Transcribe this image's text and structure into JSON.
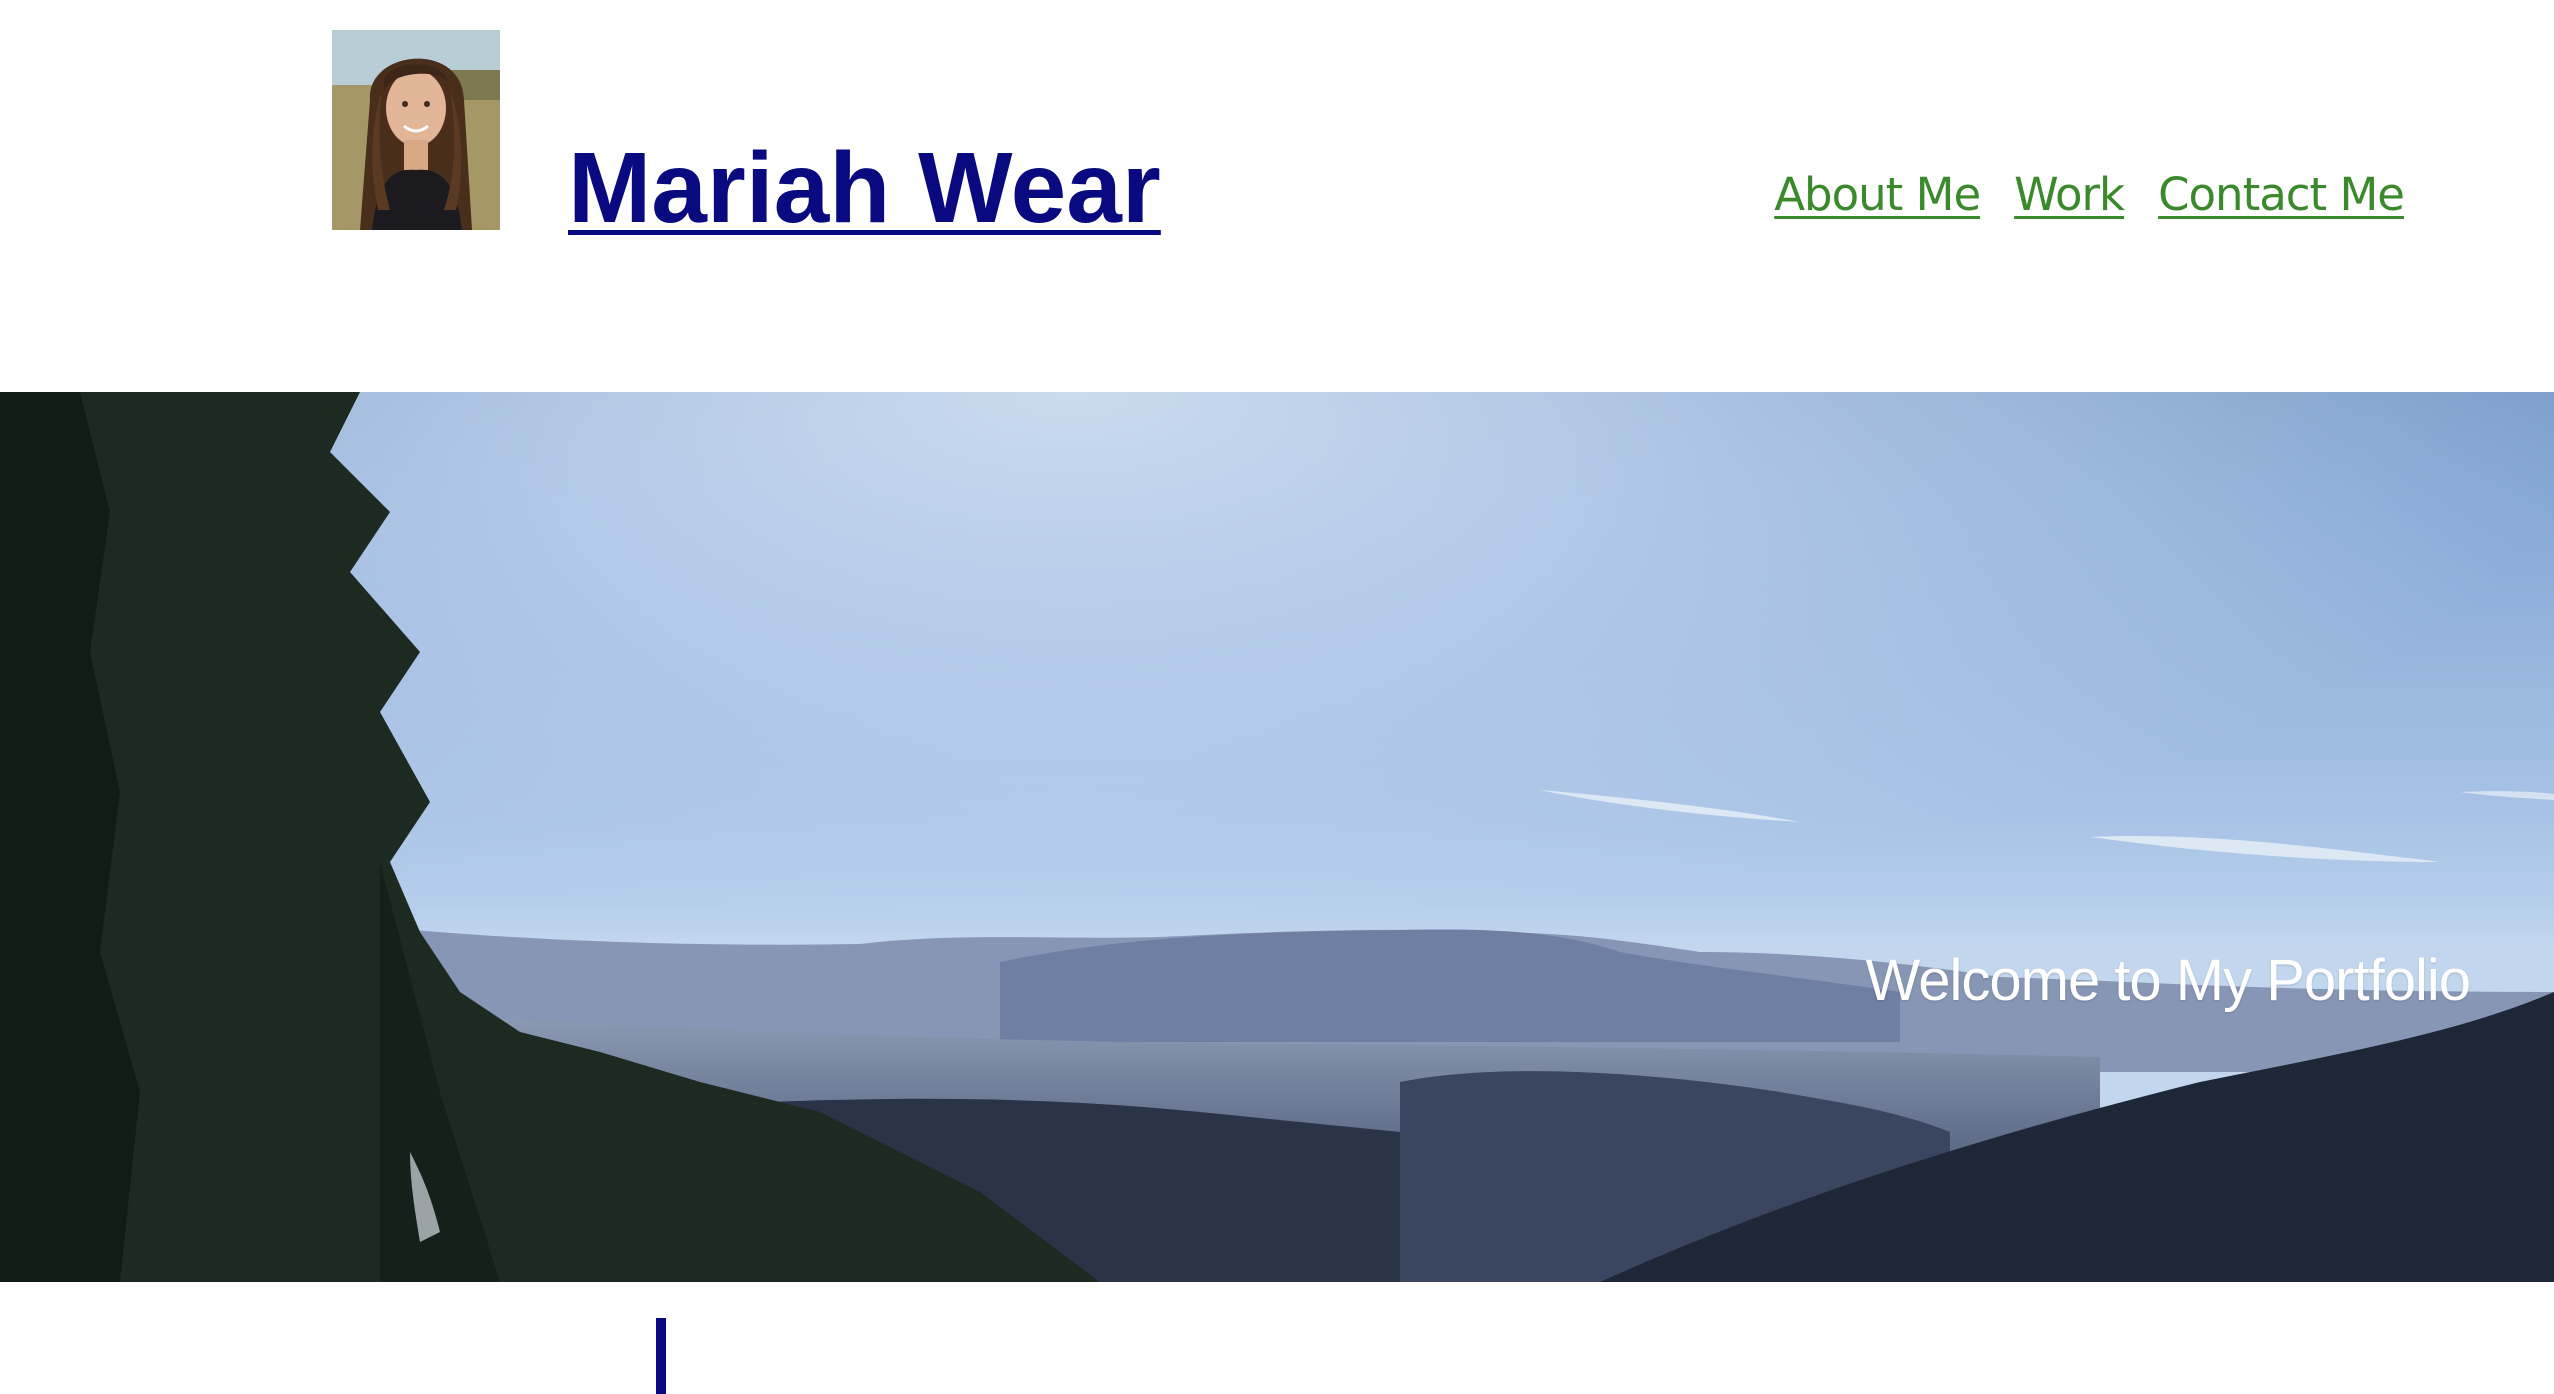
{
  "header": {
    "site_title": "Mariah Wear",
    "avatar_alt": "Portrait photo of Mariah Wear",
    "nav": [
      {
        "label": "About Me"
      },
      {
        "label": "Work"
      },
      {
        "label": "Contact Me"
      }
    ]
  },
  "hero": {
    "caption": "Welcome to My Portfolio",
    "image_alt": "Mountain valley landscape with evergreen trees under a blue sky"
  },
  "colors": {
    "title": "#0a0a80",
    "nav_link": "#3a8a2c",
    "caption": "#ffffff",
    "background": "#ffffff"
  }
}
